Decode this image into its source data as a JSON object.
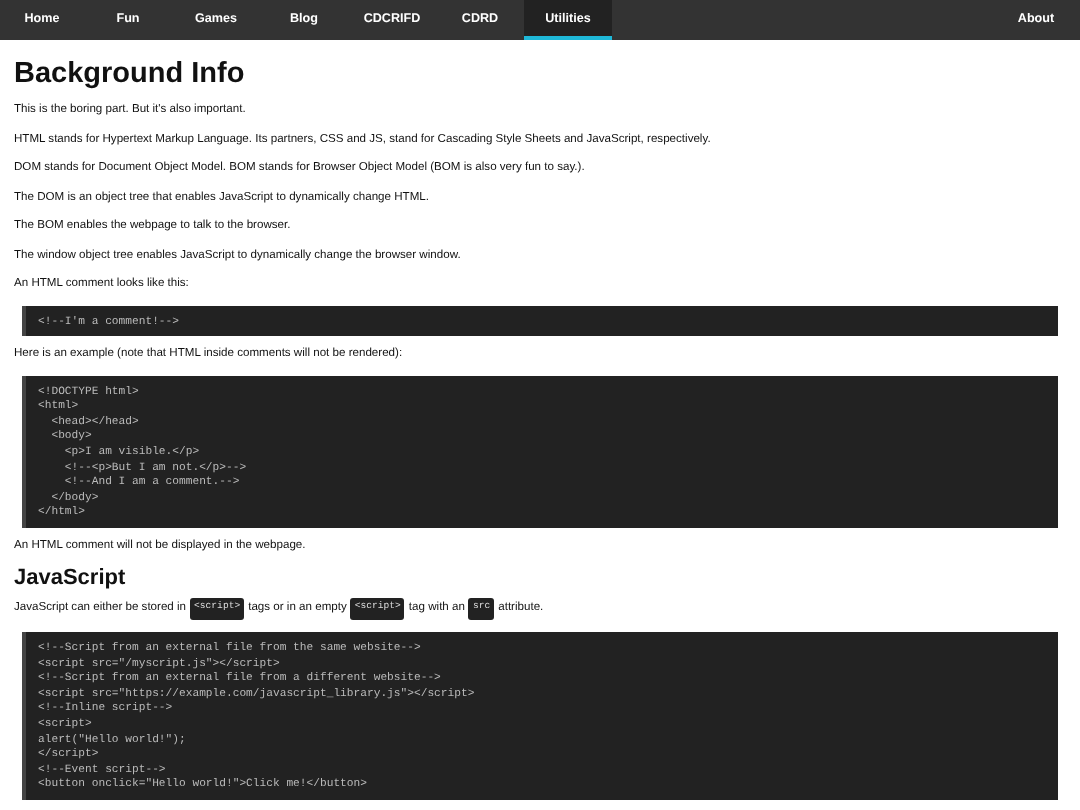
{
  "nav": {
    "items": [
      {
        "label": "Home",
        "selected": false
      },
      {
        "label": "Fun",
        "selected": false
      },
      {
        "label": "Games",
        "selected": false
      },
      {
        "label": "Blog",
        "selected": false
      },
      {
        "label": "CDCRIFD",
        "selected": false
      },
      {
        "label": "CDRD",
        "selected": false
      },
      {
        "label": "Utilities",
        "selected": true
      }
    ],
    "right_item": {
      "label": "About",
      "selected": false
    }
  },
  "content": [
    {
      "kind": "h1",
      "text": "Background Info"
    },
    {
      "kind": "p",
      "parts": [
        {
          "kind": "text",
          "text": "This is the boring part. But it's also important."
        }
      ]
    },
    {
      "kind": "p",
      "parts": [
        {
          "kind": "text",
          "text": "HTML stands for Hypertext Markup Language. Its partners, CSS and JS, stand for Cascading Style Sheets and JavaScript, respectively."
        }
      ]
    },
    {
      "kind": "p",
      "parts": [
        {
          "kind": "text",
          "text": "DOM stands for Document Object Model. BOM stands for Browser Object Model (BOM is also very fun to say.)."
        }
      ]
    },
    {
      "kind": "p",
      "parts": [
        {
          "kind": "text",
          "text": "The DOM is an object tree that enables JavaScript to dynamically change HTML."
        }
      ]
    },
    {
      "kind": "p",
      "parts": [
        {
          "kind": "text",
          "text": "The BOM enables the webpage to talk to the browser."
        }
      ]
    },
    {
      "kind": "p",
      "parts": [
        {
          "kind": "text",
          "text": "The window object tree enables JavaScript to dynamically change the browser window."
        }
      ]
    },
    {
      "kind": "p",
      "parts": [
        {
          "kind": "text",
          "text": "An HTML comment looks like this:"
        }
      ]
    },
    {
      "kind": "code",
      "lines": [
        "<!--I'm a comment!-->"
      ]
    },
    {
      "kind": "p",
      "parts": [
        {
          "kind": "text",
          "text": "Here is an example (note that HTML inside comments will not be rendered):"
        }
      ]
    },
    {
      "kind": "code",
      "lines": [
        "<!DOCTYPE html>",
        "<html>",
        "  <head></head>",
        "  <body>",
        "    <p>I am visible.</p>",
        "    <!--<p>But I am not.</p>-->",
        "    <!--And I am a comment.-->",
        "  </body>",
        "</html>"
      ]
    },
    {
      "kind": "p",
      "parts": [
        {
          "kind": "text",
          "text": "An HTML comment will not be displayed in the webpage."
        }
      ]
    },
    {
      "kind": "h2",
      "text": "JavaScript"
    },
    {
      "kind": "p",
      "parts": [
        {
          "kind": "text",
          "text": "JavaScript can either be stored in"
        },
        {
          "kind": "code",
          "text": "<script>"
        },
        {
          "kind": "text",
          "text": "tags or in an empty"
        },
        {
          "kind": "code",
          "text": "<script>"
        },
        {
          "kind": "text",
          "text": "tag with an"
        },
        {
          "kind": "code",
          "text": "src"
        },
        {
          "kind": "text",
          "text": "attribute."
        }
      ]
    },
    {
      "kind": "code",
      "lines": [
        "<!--Script from an external file from the same website-->",
        "<script src=\"/myscript.js\"></script>",
        "<!--Script from an external file from a different website-->",
        "<script src=\"https://example.com/javascript_library.js\"></script>",
        "<!--Inline script-->",
        "<script>",
        "alert(\"Hello world!\");",
        "</script>",
        "<!--Event script-->",
        "<button onclick=\"Hello world!\">Click me!</button>"
      ]
    }
  ]
}
